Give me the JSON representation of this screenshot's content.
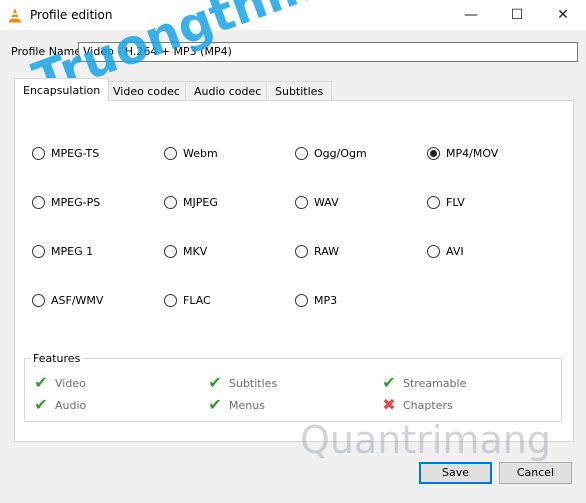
{
  "window": {
    "title": "Profile edition",
    "minimize": "—",
    "maximize": "☐",
    "close": "✕"
  },
  "profile": {
    "label": "Profile Name",
    "value": "Video - H.264 + MP3 (MP4)"
  },
  "tabs": [
    {
      "label": "Encapsulation",
      "active": true
    },
    {
      "label": "Video codec",
      "active": false
    },
    {
      "label": "Audio codec",
      "active": false
    },
    {
      "label": "Subtitles",
      "active": false
    }
  ],
  "formats": [
    {
      "label": "MPEG-TS",
      "selected": false
    },
    {
      "label": "Webm",
      "selected": false
    },
    {
      "label": "Ogg/Ogm",
      "selected": false
    },
    {
      "label": "MP4/MOV",
      "selected": true
    },
    {
      "label": "MPEG-PS",
      "selected": false
    },
    {
      "label": "MJPEG",
      "selected": false
    },
    {
      "label": "WAV",
      "selected": false
    },
    {
      "label": "FLV",
      "selected": false
    },
    {
      "label": "MPEG 1",
      "selected": false
    },
    {
      "label": "MKV",
      "selected": false
    },
    {
      "label": "RAW",
      "selected": false
    },
    {
      "label": "AVI",
      "selected": false
    },
    {
      "label": "ASF/WMV",
      "selected": false
    },
    {
      "label": "FLAC",
      "selected": false
    },
    {
      "label": "MP3",
      "selected": false
    }
  ],
  "features": {
    "title": "Features",
    "items": [
      {
        "label": "Video",
        "supported": true,
        "mark": "✔"
      },
      {
        "label": "Subtitles",
        "supported": true,
        "mark": "✔"
      },
      {
        "label": "Streamable",
        "supported": true,
        "mark": "✔"
      },
      {
        "label": "Audio",
        "supported": true,
        "mark": "✔"
      },
      {
        "label": "Menus",
        "supported": true,
        "mark": "✔"
      },
      {
        "label": "Chapters",
        "supported": false,
        "mark": "✖"
      }
    ]
  },
  "buttons": {
    "save": "Save",
    "cancel": "Cancel"
  },
  "watermarks": {
    "top": "Truongthinh.top",
    "bottom": "Quantrimang"
  },
  "colors": {
    "accent": "#0078d7",
    "check": "#2e9d2e",
    "cross": "#e04a4a"
  }
}
